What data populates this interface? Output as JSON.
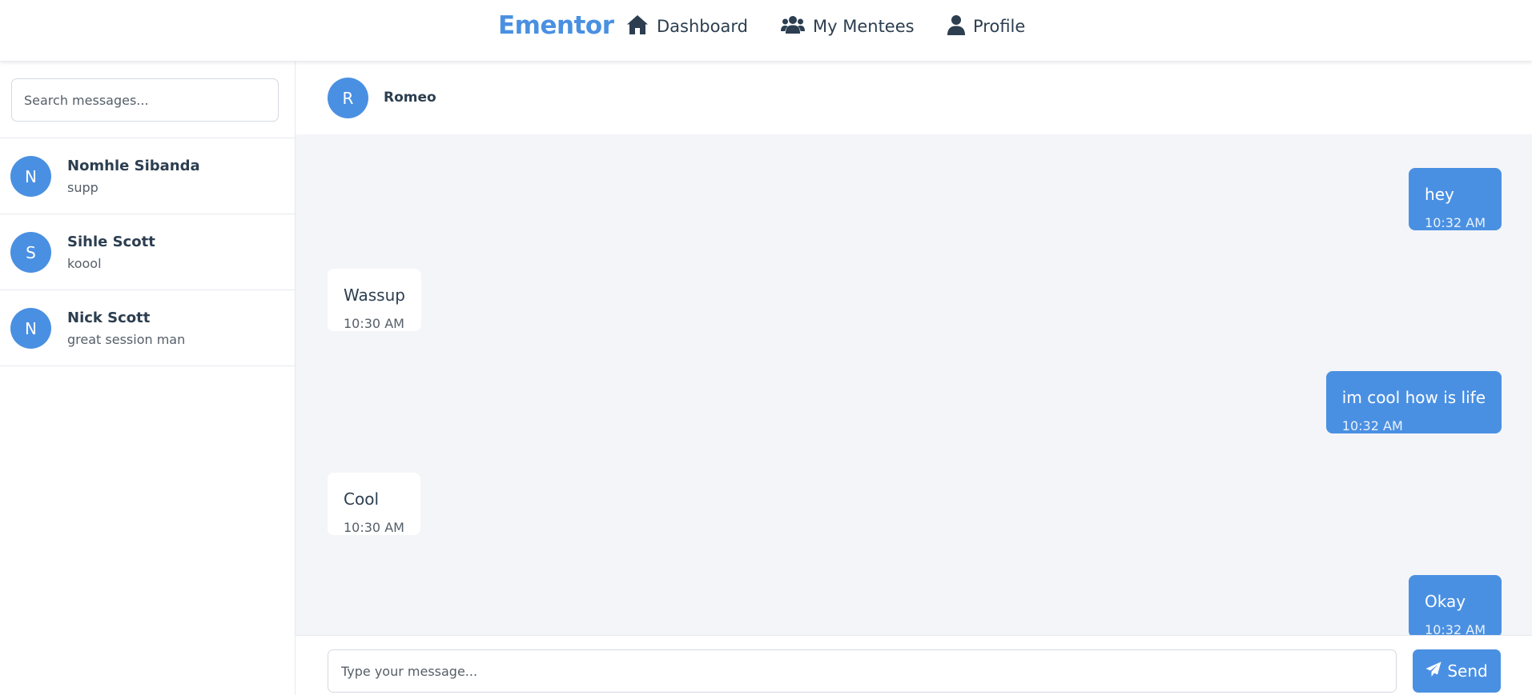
{
  "nav": {
    "brand": "Ementor",
    "links": [
      {
        "label": "Dashboard",
        "icon": "home-icon"
      },
      {
        "label": "My Mentees",
        "icon": "users-icon"
      },
      {
        "label": "Profile",
        "icon": "user-icon"
      }
    ]
  },
  "sidebar": {
    "search_placeholder": "Search messages...",
    "conversations": [
      {
        "initial": "N",
        "name": "Nomhle Sibanda",
        "last_message": "supp"
      },
      {
        "initial": "S",
        "name": "Sihle Scott",
        "last_message": "koool"
      },
      {
        "initial": "N",
        "name": "Nick Scott",
        "last_message": "great session man"
      }
    ]
  },
  "chat": {
    "contact_initial": "R",
    "contact_name": "Romeo",
    "messages": [
      {
        "direction": "sent",
        "text": "hey",
        "time": "10:32 AM"
      },
      {
        "direction": "received",
        "text": "Wassup",
        "time": "10:30 AM"
      },
      {
        "direction": "sent",
        "text": "im cool how is life",
        "time": "10:32 AM"
      },
      {
        "direction": "received",
        "text": "Cool",
        "time": "10:30 AM"
      },
      {
        "direction": "sent",
        "text": "Okay",
        "time": "10:32 AM"
      }
    ],
    "input_placeholder": "Type your message...",
    "send_label": "Send"
  },
  "colors": {
    "accent": "#4a90e2",
    "text": "#2c3e50",
    "chat_bg": "#f4f5f8"
  }
}
